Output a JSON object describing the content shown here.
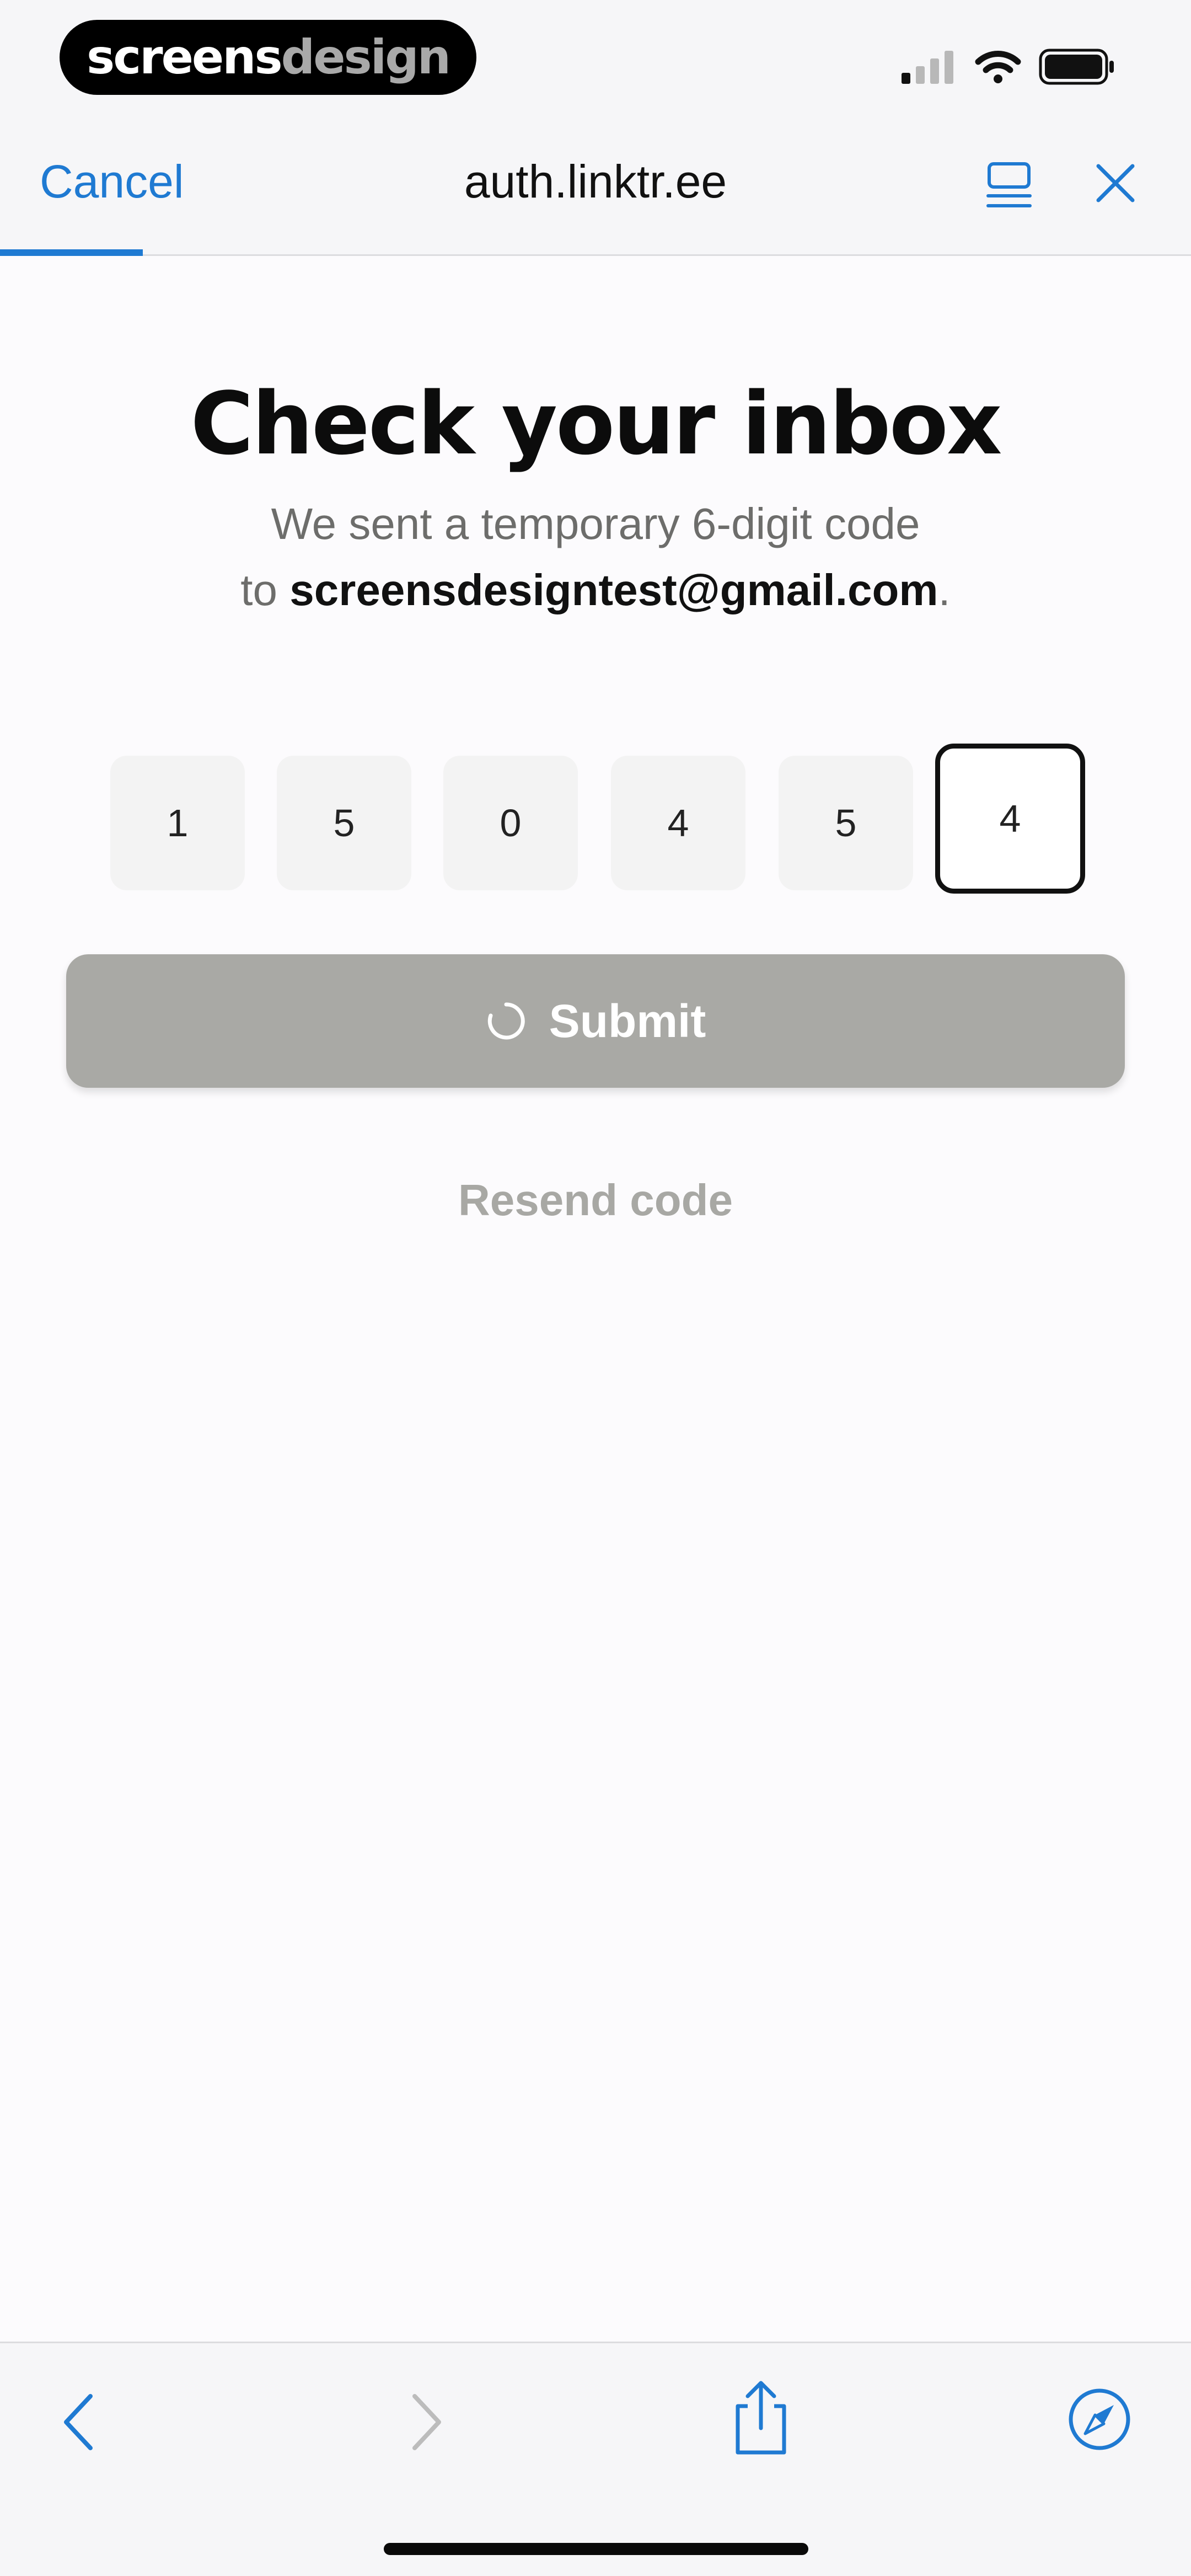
{
  "status_bar": {
    "brand_part1": "screens",
    "brand_part2": "design",
    "icons": [
      "signal-icon",
      "wifi-icon",
      "battery-icon"
    ]
  },
  "browser": {
    "cancel_label": "Cancel",
    "url": "auth.linktr.ee",
    "load_progress": 0.12,
    "icons": [
      "reader-icon",
      "close-icon"
    ]
  },
  "verify": {
    "title": "Check your inbox",
    "subtitle_line1": "We sent a temporary 6-digit code",
    "subtitle_to": "to ",
    "email": "screensdesigntest@gmail.com",
    "subtitle_end": ".",
    "code_digits": [
      "1",
      "5",
      "0",
      "4",
      "5",
      "4"
    ],
    "active_index": 5,
    "submit_label": "Submit",
    "resend_label": "Resend code"
  },
  "toolbar": {
    "icons": [
      "back-icon",
      "forward-icon",
      "share-icon",
      "compass-icon"
    ]
  },
  "colors": {
    "accent": "#1f7ad2",
    "submit_disabled": "#a9a9a5",
    "resend_text": "#a8a8a4",
    "code_box_bg": "#f3f3f3"
  }
}
